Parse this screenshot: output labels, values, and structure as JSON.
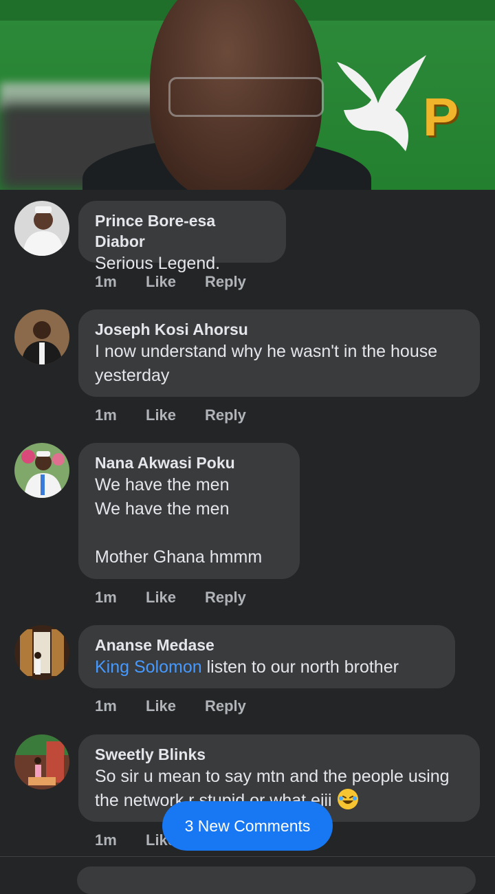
{
  "video": {
    "logo_text": "P"
  },
  "new_comments_label": "3 New Comments",
  "comments": [
    {
      "author": "Prince Bore-esa Diabor",
      "text": "Serious Legend.",
      "time": "1m",
      "like": "Like",
      "reply": "Reply"
    },
    {
      "author": "Joseph Kosi Ahorsu",
      "text": "I now understand why he wasn't in the house yesterday",
      "time": "1m",
      "like": "Like",
      "reply": "Reply"
    },
    {
      "author": "Nana Akwasi Poku",
      "text": "We have the men\nWe have the men\n\nMother Ghana hmmm",
      "time": "1m",
      "like": "Like",
      "reply": "Reply"
    },
    {
      "author": "Ananse Medase",
      "mention": "King Solomon",
      "text": " listen to our north brother",
      "time": "1m",
      "like": "Like",
      "reply": "Reply"
    },
    {
      "author": "Sweetly Blinks",
      "text": "So sir u mean to say mtn and the people using the network r stupid or what eiii",
      "emoji": "laughing-emoji",
      "time": "1m",
      "like": "Like"
    }
  ]
}
